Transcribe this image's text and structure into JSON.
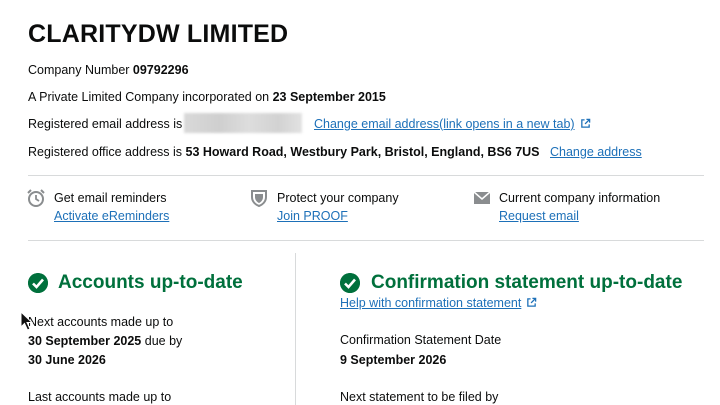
{
  "company": {
    "name": "CLARITYDW LIMITED",
    "number_label": "Company Number ",
    "number": "09792296",
    "type_text": "A Private Limited Company incorporated on ",
    "incorporated_date": "23 September 2015",
    "email_label": "Registered email address is ",
    "change_email_link": "Change email address(link opens in a new tab)",
    "office_label": "Registered office address is ",
    "office_address": "53 Howard Road, Westbury Park, Bristol, England, BS6 7US",
    "change_address_link": "Change address"
  },
  "services": [
    {
      "icon": "alarm-clock-icon",
      "title": "Get email reminders",
      "link": "Activate eReminders"
    },
    {
      "icon": "shield-icon",
      "title": "Protect your company",
      "link": "Join PROOF"
    },
    {
      "icon": "envelope-icon",
      "title": "Current company information",
      "link": "Request email"
    }
  ],
  "accounts": {
    "title": "Accounts up-to-date",
    "next_label": "Next accounts made up to",
    "next_date": "30 September 2025",
    "due_text": " due by",
    "due_date": "30 June 2026",
    "last_label": "Last accounts made up to"
  },
  "confirmation": {
    "title": "Confirmation statement up-to-date",
    "help_link": "Help with confirmation statement",
    "date_label": "Confirmation Statement Date",
    "date": "9 September 2026",
    "next_label": "Next statement to be filed by"
  },
  "colors": {
    "link": "#1d70b8",
    "success_green": "#00703c",
    "text": "#0b0c0c"
  }
}
